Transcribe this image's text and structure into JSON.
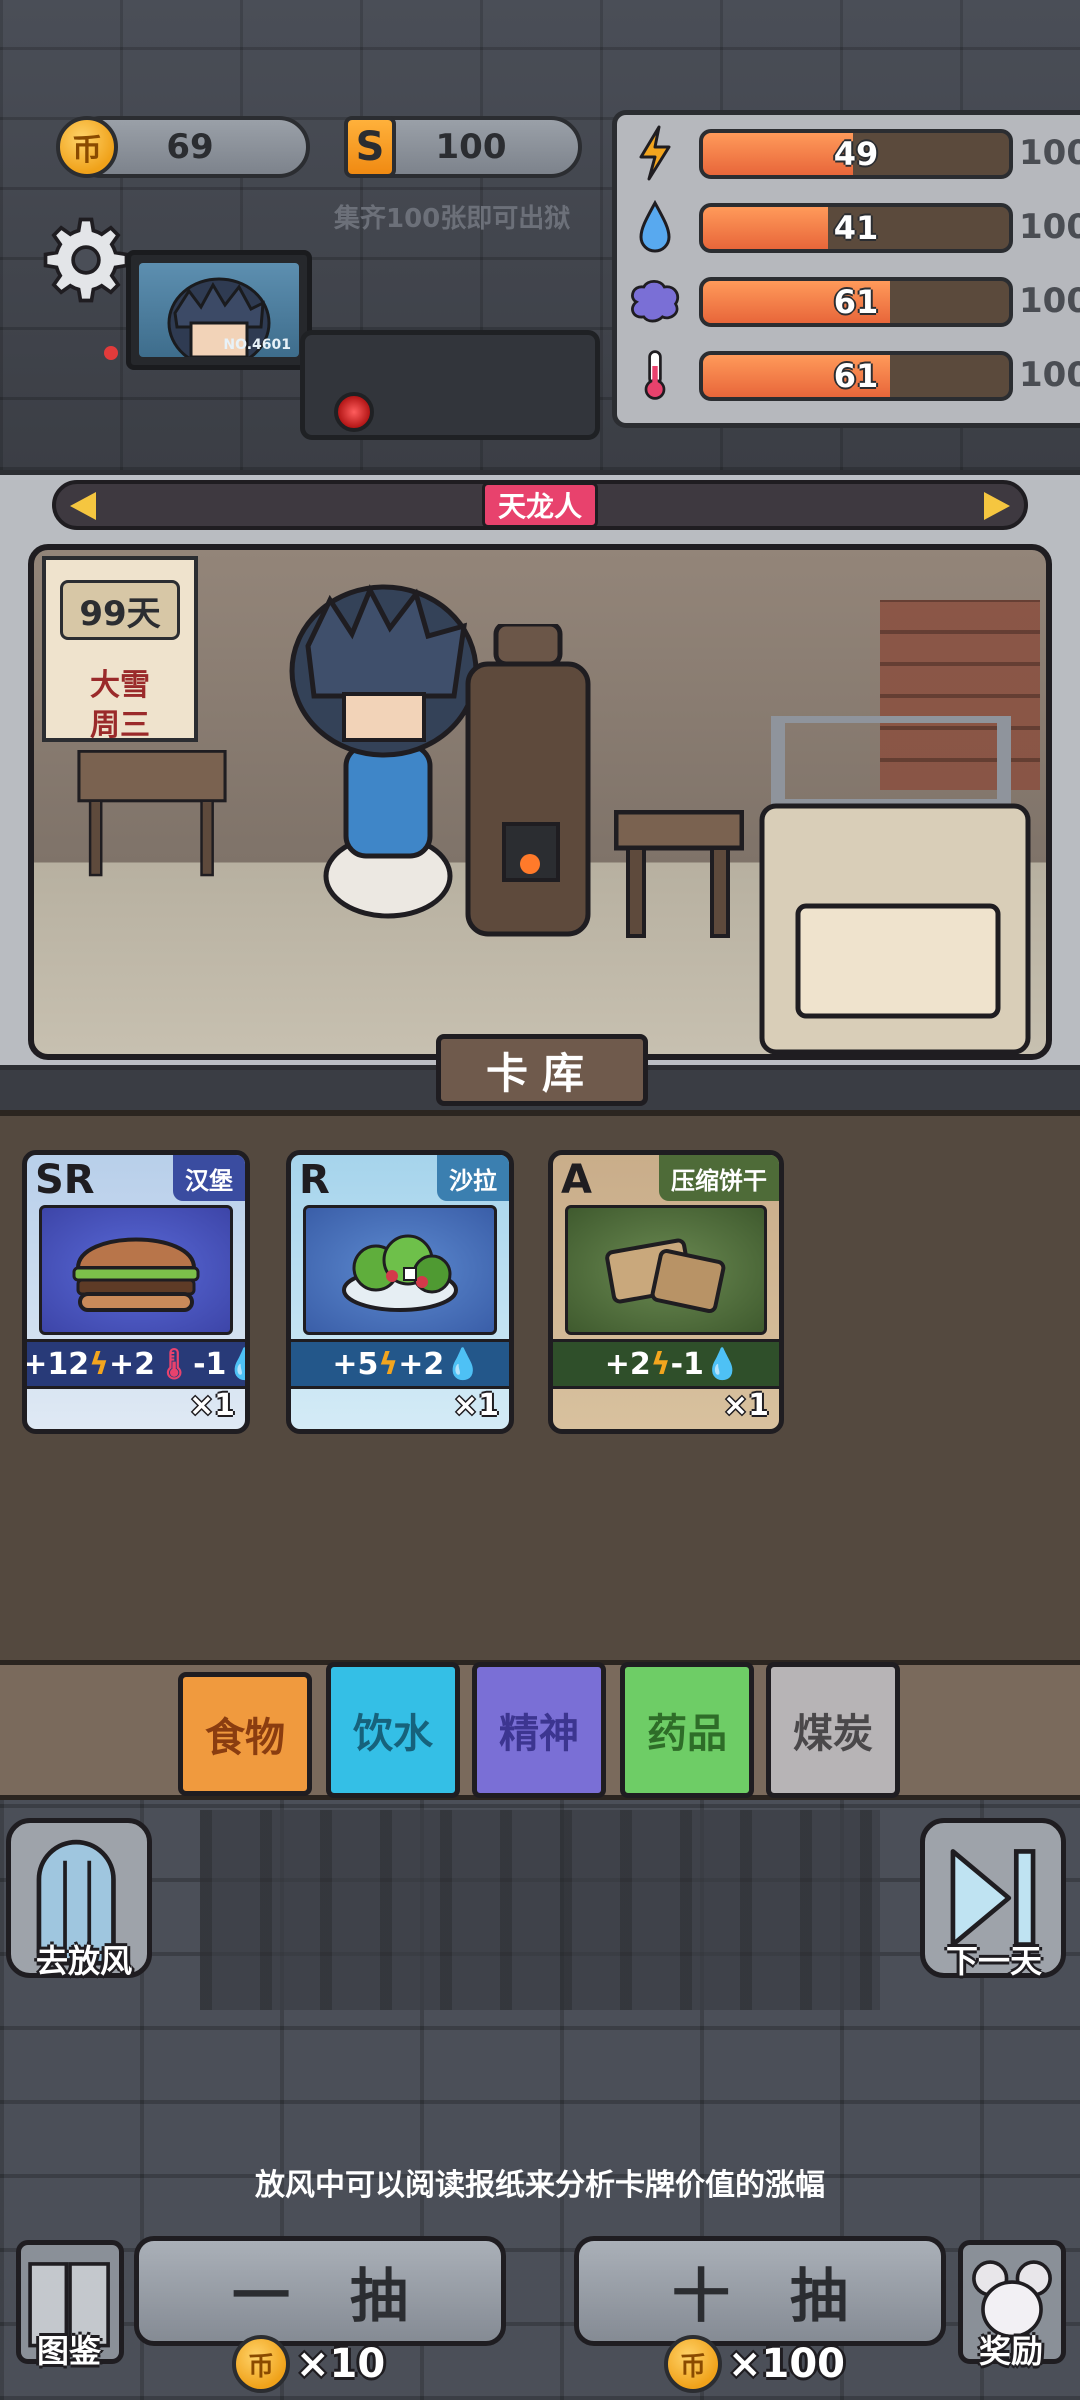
{
  "header": {
    "coins": "69",
    "coin_symbol": "币",
    "s_symbol": "S",
    "s_cards": "100",
    "hint": "集齐100张即可出狱",
    "monitor_no": "NO.4601"
  },
  "stats": [
    {
      "name": "energy",
      "icon": "lightning-icon",
      "value": "49",
      "max": "100",
      "level": 0.49
    },
    {
      "name": "water",
      "icon": "water-drop-icon",
      "value": "41",
      "max": "100",
      "level": 0.41
    },
    {
      "name": "mind",
      "icon": "brain-icon",
      "value": "61",
      "max": "100",
      "level": 0.61
    },
    {
      "name": "temperature",
      "icon": "thermometer-icon",
      "value": "61",
      "max": "100",
      "level": 0.61
    }
  ],
  "scene": {
    "character_name": "天龙人",
    "calendar": {
      "days": "99天",
      "weather": "大雪",
      "weekday": "周三"
    },
    "card_library_label": "卡库"
  },
  "cards": [
    {
      "rarity": "SR",
      "name": "汉堡",
      "effect": [
        {
          "text": "+12",
          "icon": "bolt"
        },
        {
          "text": "+2",
          "icon": "temp"
        },
        {
          "text": "-1",
          "icon": "drop"
        }
      ],
      "count": "×1",
      "art": "burger-icon"
    },
    {
      "rarity": "R",
      "name": "沙拉",
      "effect": [
        {
          "text": "+5",
          "icon": "bolt"
        },
        {
          "text": "+2",
          "icon": "drop"
        }
      ],
      "count": "×1",
      "art": "salad-icon"
    },
    {
      "rarity": "A",
      "name": "压缩饼干",
      "effect": [
        {
          "text": "+2",
          "icon": "bolt"
        },
        {
          "text": "-1",
          "icon": "drop"
        }
      ],
      "count": "×1",
      "art": "biscuit-icon"
    }
  ],
  "tabs": [
    {
      "label": "食物",
      "selected": true
    },
    {
      "label": "饮水",
      "selected": false
    },
    {
      "label": "精神",
      "selected": false
    },
    {
      "label": "药品",
      "selected": false
    },
    {
      "label": "煤炭",
      "selected": false
    }
  ],
  "bottom": {
    "left_label": "去放风",
    "right_label": "下一天",
    "tip": "放风中可以阅读报纸来分析卡牌价值的涨幅",
    "single_draw": {
      "label": "一抽",
      "cost": "×10"
    },
    "ten_draw": {
      "label": "十抽",
      "cost": "×100"
    },
    "album_label": "图鉴",
    "reward_label": "奖励"
  },
  "colors": {
    "accent_orange": "#f09a3e",
    "name_pink": "#e8426d",
    "bar_fill": "#e8663a"
  }
}
